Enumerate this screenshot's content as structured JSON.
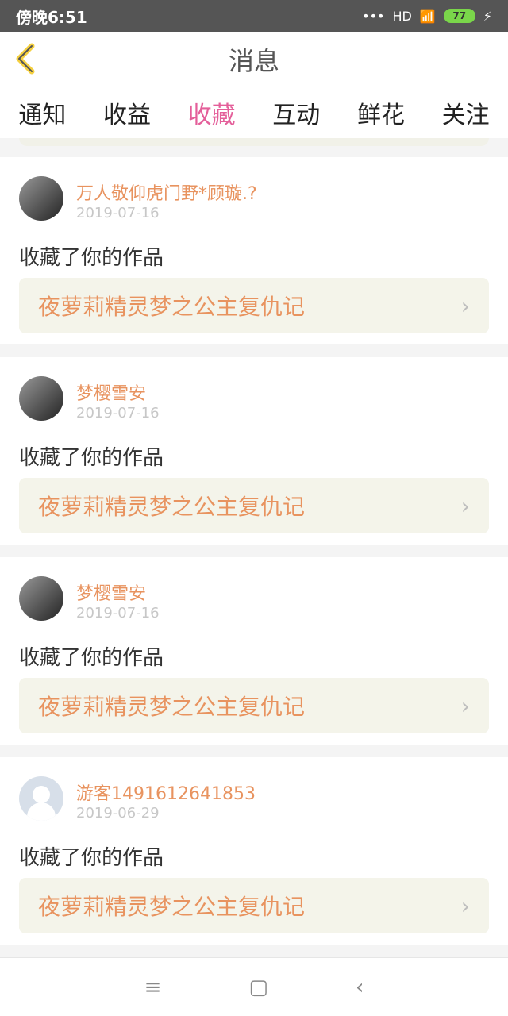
{
  "status": {
    "time": "傍晚6:51",
    "signal": "HD",
    "battery": "77"
  },
  "header": {
    "title": "消息"
  },
  "tabs": [
    {
      "label": "通知"
    },
    {
      "label": "收益"
    },
    {
      "label": "收藏"
    },
    {
      "label": "互动"
    },
    {
      "label": "鲜花"
    },
    {
      "label": "关注"
    }
  ],
  "items": [
    {
      "name": "万人敬仰虎门野*顾璇.?",
      "date": "2019-07-16",
      "action": "收藏了你的作品",
      "work": "夜萝莉精灵梦之公主复仇记"
    },
    {
      "name": "梦樱雪安",
      "date": "2019-07-16",
      "action": "收藏了你的作品",
      "work": "夜萝莉精灵梦之公主复仇记"
    },
    {
      "name": "梦樱雪安",
      "date": "2019-07-16",
      "action": "收藏了你的作品",
      "work": "夜萝莉精灵梦之公主复仇记"
    },
    {
      "name": "游客1491612641853",
      "date": "2019-06-29",
      "action": "收藏了你的作品",
      "work": "夜萝莉精灵梦之公主复仇记"
    }
  ],
  "colors": {
    "accent": "#e45f9a",
    "name": "#e8935f",
    "workBg": "#f4f4ea"
  }
}
